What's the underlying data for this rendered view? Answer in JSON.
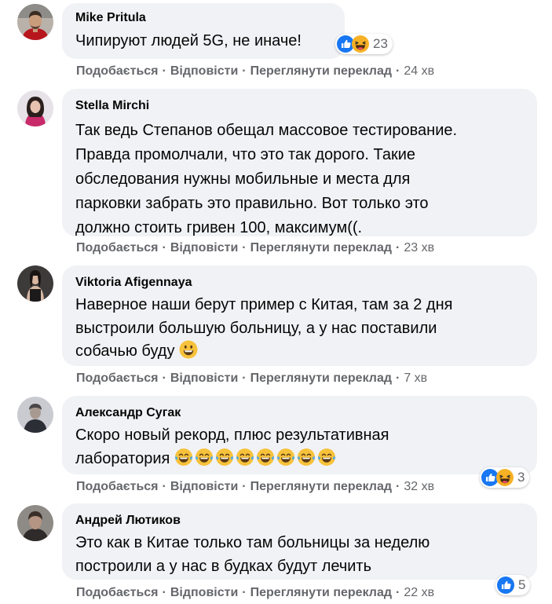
{
  "actions": {
    "like": "Подобається",
    "reply": "Відповісти",
    "translate": "Переглянути переклад",
    "separator": "·"
  },
  "comments": [
    {
      "author": "Mike Pritula",
      "text": "Чипируют людей 5G, не иначе!",
      "time": "24 хв",
      "reactions": {
        "icons": [
          "like-icon",
          "haha-icon"
        ],
        "count": "23"
      }
    },
    {
      "author": "Stella Mirchi",
      "text": "Так ведь Степанов обещал массовое тестирование.\nПравда промолчали, что это так дорого. Такие\nобследования нужны мобильные и места для\nпарковки забрать это правильно. Вот только это\nдолжно стоить гривен 100, максимум((.",
      "time": "23 хв"
    },
    {
      "author": "Viktoria Afigennaya",
      "text_lines": [
        "Наверное наши берут пример с Китая, там за 2 дня",
        "выстроили большую больницу, а у нас поставили",
        "собачью буду"
      ],
      "emoji": [
        "grinning-emoji-icon"
      ],
      "time": "7 хв"
    },
    {
      "author": "Александр Сугак",
      "text_lines": [
        "Скоро новый рекорд, плюс результативная",
        "лаборатория"
      ],
      "emoji_count": 8,
      "emoji_name": "tears-of-joy-emoji-icon",
      "time": "32 хв",
      "reactions": {
        "icons": [
          "like-icon",
          "haha-icon"
        ],
        "count": "3"
      }
    },
    {
      "author": "Андрей Лютиков",
      "text": "Это как в Китае только там больницы за неделю\nпостроили а у нас в будках будут лечить",
      "time": "22 хв",
      "reactions": {
        "icons": [
          "like-icon"
        ],
        "count": "5"
      }
    }
  ],
  "colors": {
    "bubble": "#f0f2f5",
    "meta_text": "#65676b",
    "like_blue": "#1877f2",
    "haha_yellow": "#f7b125"
  }
}
